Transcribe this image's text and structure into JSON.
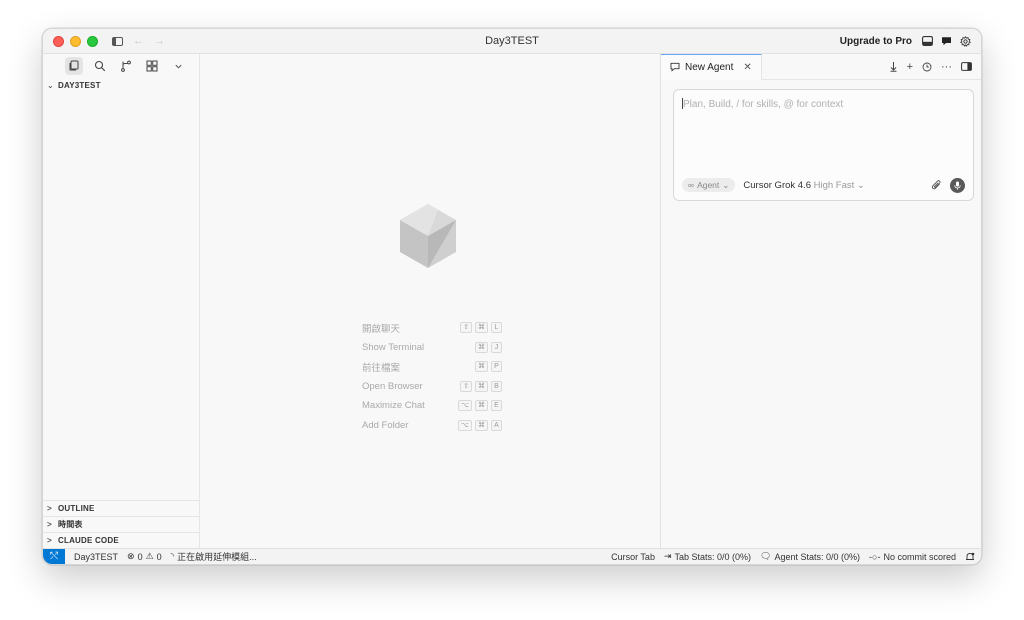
{
  "window": {
    "title": "Day3TEST"
  },
  "titlebar": {
    "upgrade_label": "Upgrade to Pro",
    "back_arrow": "←",
    "forward_arrow": "→"
  },
  "sidebar": {
    "workspace_section": "DAY3TEST",
    "bottom_sections": [
      "OUTLINE",
      "時間表",
      "CLAUDE CODE"
    ],
    "chevron_expanded": "⌄",
    "chevron_collapsed": ">"
  },
  "editor": {
    "shortcuts": [
      {
        "label": "開啟聊天",
        "keys": [
          "⇧",
          "⌘",
          "L"
        ]
      },
      {
        "label": "Show Terminal",
        "keys": [
          "",
          "⌘",
          "J"
        ]
      },
      {
        "label": "前往檔案",
        "keys": [
          "",
          "⌘",
          "P"
        ]
      },
      {
        "label": "Open Browser",
        "keys": [
          "⇧",
          "⌘",
          "B"
        ]
      },
      {
        "label": "Maximize Chat",
        "keys": [
          "⌥",
          "⌘",
          "E"
        ]
      },
      {
        "label": "Add Folder",
        "keys": [
          "⌥",
          "⌘",
          "A"
        ]
      }
    ]
  },
  "agent": {
    "tab_label": "New Agent",
    "placeholder": "Plan, Build, / for skills, @ for context",
    "mode_label": "Agent",
    "model_name": "Cursor Grok 4.6",
    "model_variant": "High Fast",
    "actions": {
      "plus": "+",
      "more": "···"
    }
  },
  "statusbar": {
    "remote_icon": "⤲",
    "workspace": "Day3TEST",
    "errors": "0",
    "warnings": "0",
    "loading": "正在啟用延伸模組...",
    "cursor_tab": "Cursor Tab",
    "tab_stats": "Tab Stats: 0/0 (0%)",
    "agent_stats": "Agent Stats: 0/0 (0%)",
    "commit": "No commit scored"
  },
  "colors": {
    "accent": "#0078d4",
    "tab_highlight": "#6aa6f5"
  }
}
